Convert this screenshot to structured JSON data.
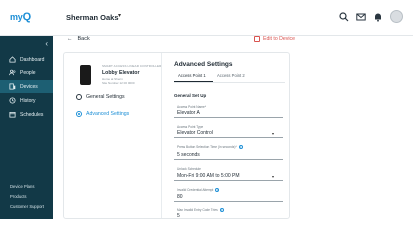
{
  "header": {
    "logo_text": "my",
    "logo_mark": "Q",
    "site_name": "Sherman Oaks",
    "icons": [
      "search-icon",
      "mail-icon",
      "bell-icon",
      "avatar"
    ]
  },
  "sidebar": {
    "collapse_glyph": "‹",
    "items": [
      {
        "label": "Dashboard",
        "icon": "home-icon"
      },
      {
        "label": "People",
        "icon": "people-icon"
      },
      {
        "label": "Devices",
        "icon": "devices-icon"
      },
      {
        "label": "History",
        "icon": "history-icon"
      },
      {
        "label": "Schedules",
        "icon": "calendar-icon"
      }
    ],
    "footer": [
      "Device Plans",
      "Products",
      "Customer Support"
    ]
  },
  "content": {
    "back_label": "Back",
    "add_device_label": "Edit to Device"
  },
  "device": {
    "category": "SMART ACCESS LINEAR CONTROLLER",
    "name": "Lobby Elevator",
    "meta1": "Home at Sherm",
    "meta2": "Site Number 12 00 0000"
  },
  "left_menu": {
    "general": "General Settings",
    "advanced": "Advanced Settings"
  },
  "panel": {
    "title": "Advanced Settings",
    "tabs": [
      "Access Point 1",
      "Access Point 2"
    ],
    "section_title": "General Set Up",
    "fields": [
      {
        "label": "Access Point Name*",
        "value": "Elevator A"
      },
      {
        "label": "Access Point Type",
        "value": "Elevator Control"
      },
      {
        "label": "Press Button Selection Time (In seconds)*",
        "value": "5 seconds"
      },
      {
        "label": "Unlock Schedule",
        "value": "Mon-Fri 9:00 AM to 5:00 PM"
      },
      {
        "label": "Invalid Credential Attempt",
        "value": "80"
      },
      {
        "label": "Max Invalid Entry Code Tries",
        "value": "5"
      }
    ]
  },
  "colors": {
    "sidebar_bg": "#123947",
    "sidebar_active": "#1d5f73",
    "accent": "#1d8fd6",
    "danger": "#d9534f"
  }
}
